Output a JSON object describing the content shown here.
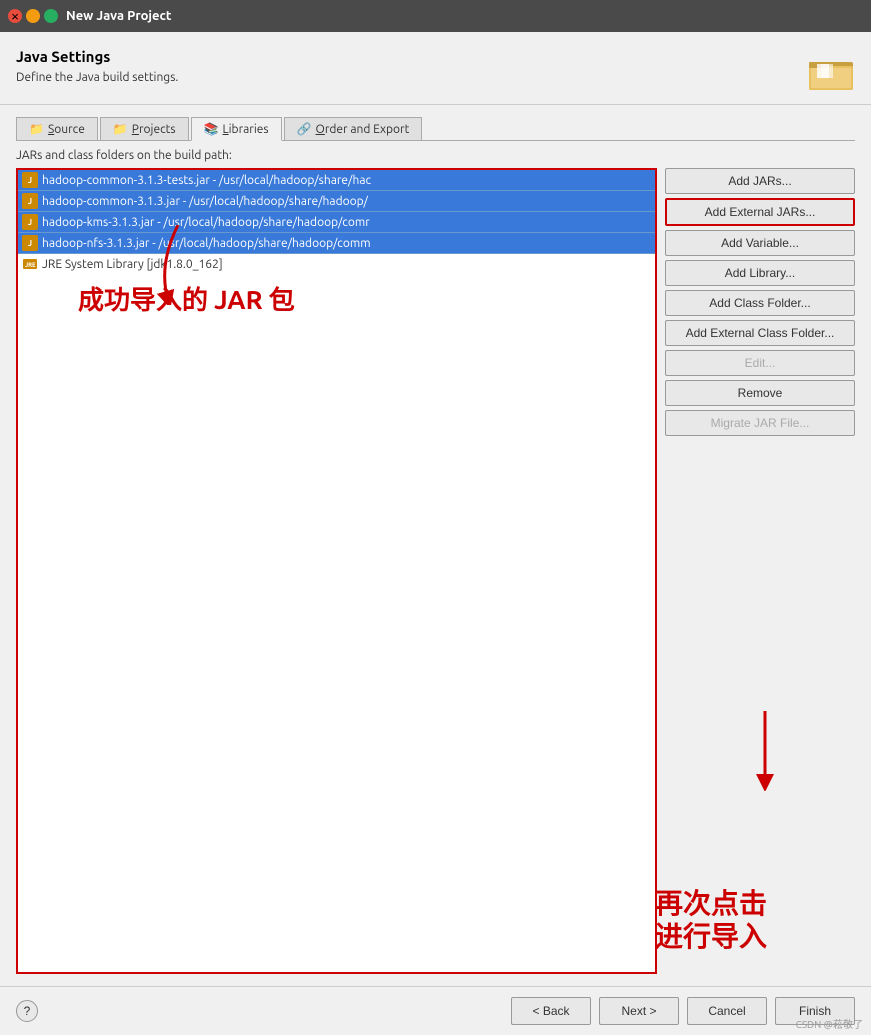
{
  "titleBar": {
    "title": "New Java Project",
    "closeBtn": "×",
    "minBtn": "−",
    "maxBtn": "□"
  },
  "header": {
    "title": "Java Settings",
    "subtitle": "Define the Java build settings.",
    "icon": "folder-icon"
  },
  "tabs": [
    {
      "label": "Source",
      "icon": "📁",
      "underline": "S",
      "active": false
    },
    {
      "label": "Projects",
      "icon": "📁",
      "underline": "P",
      "active": false
    },
    {
      "label": "Libraries",
      "icon": "📚",
      "underline": "L",
      "active": true
    },
    {
      "label": "Order and Export",
      "icon": "🔗",
      "underline": "O",
      "active": false
    }
  ],
  "sectionLabel": "JARs and class folders on the build path:",
  "jarItems": [
    {
      "text": "hadoop-common-3.1.3-tests.jar - /usr/local/hadoop/share/hac"
    },
    {
      "text": "hadoop-common-3.1.3.jar - /usr/local/hadoop/share/hadoop/"
    },
    {
      "text": "hadoop-kms-3.1.3.jar - /usr/local/hadoop/share/hadoop/comr"
    },
    {
      "text": "hadoop-nfs-3.1.3.jar - /usr/local/hadoop/share/hadoop/comm"
    }
  ],
  "jreItem": "JRE System Library [jdk1.8.0_162]",
  "annotation": {
    "left": "成功导入的 JAR 包",
    "right_line1": "再次点击",
    "right_line2": "进行导入"
  },
  "buttons": [
    {
      "label": "Add JARs...",
      "name": "add-jars-button",
      "highlighted": false,
      "disabled": false
    },
    {
      "label": "Add External JARs...",
      "name": "add-external-jars-button",
      "highlighted": true,
      "disabled": false
    },
    {
      "label": "Add Variable...",
      "name": "add-variable-button",
      "highlighted": false,
      "disabled": false
    },
    {
      "label": "Add Library...",
      "name": "add-library-button",
      "highlighted": false,
      "disabled": false
    },
    {
      "label": "Add Class Folder...",
      "name": "add-class-folder-button",
      "highlighted": false,
      "disabled": false
    },
    {
      "label": "Add External Class Folder...",
      "name": "add-external-class-folder-button",
      "highlighted": false,
      "disabled": false
    },
    {
      "label": "Edit...",
      "name": "edit-button",
      "highlighted": false,
      "disabled": true
    },
    {
      "label": "Remove",
      "name": "remove-button",
      "highlighted": false,
      "disabled": false
    },
    {
      "label": "Migrate JAR File...",
      "name": "migrate-button",
      "highlighted": false,
      "disabled": true
    }
  ],
  "footer": {
    "help": "?",
    "back": "< Back",
    "next": "Next >",
    "cancel": "Cancel",
    "finish": "Finish"
  },
  "watermark": "CSDN @菘敬了"
}
